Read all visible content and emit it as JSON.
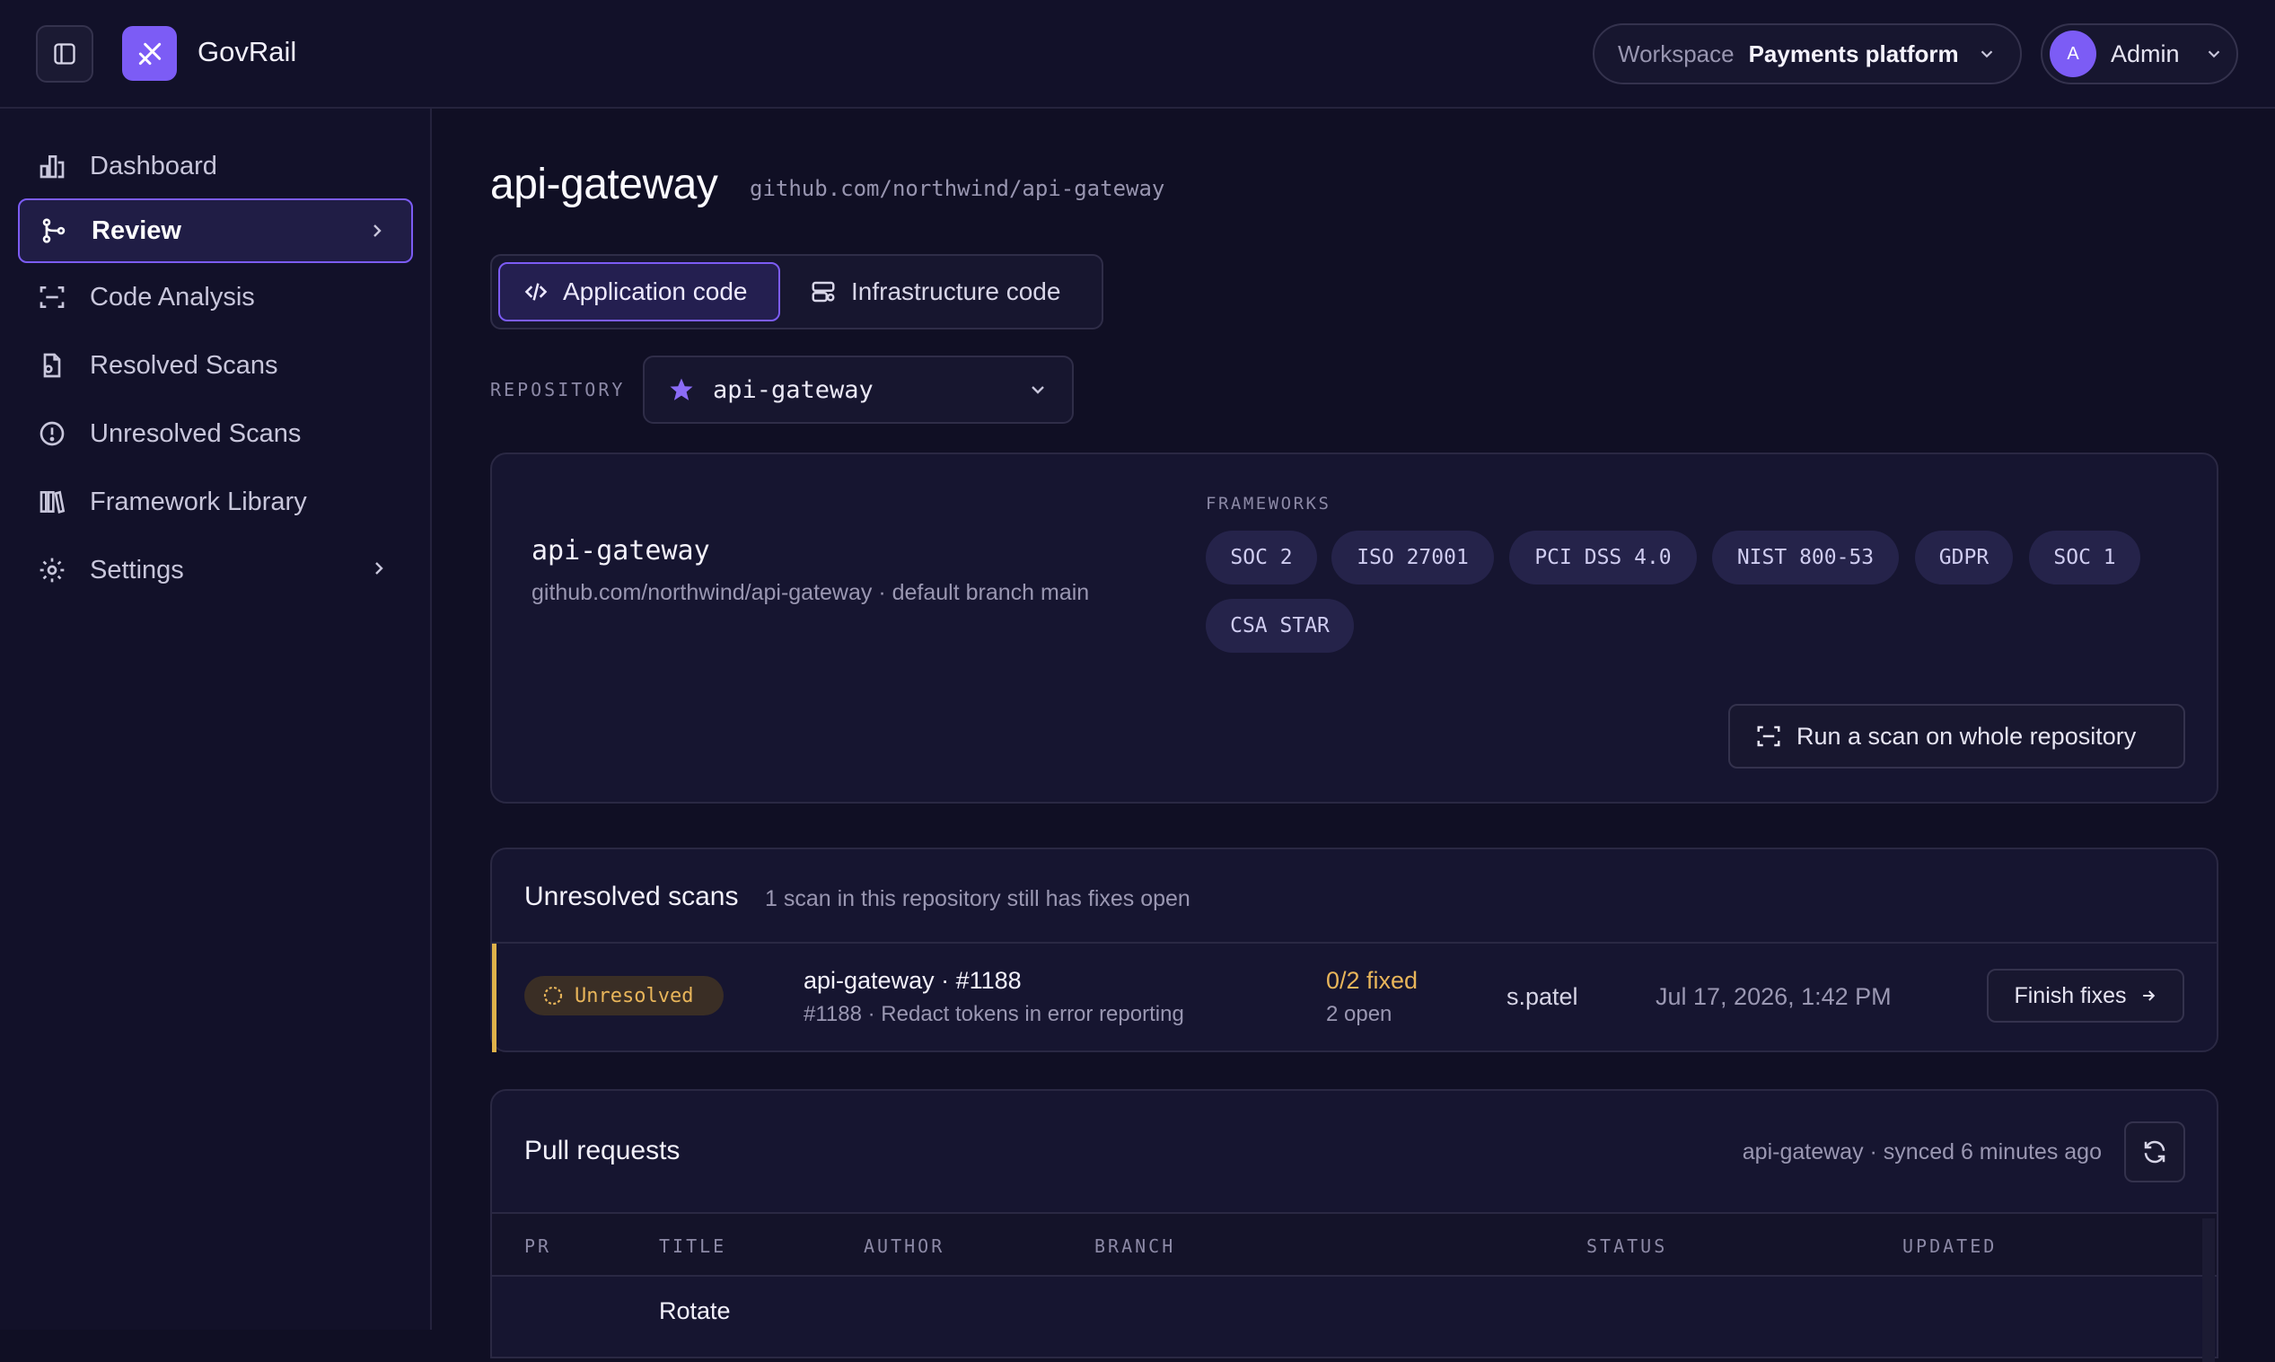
{
  "app": {
    "brand": "GovRail"
  },
  "header": {
    "workspace_label": "Workspace",
    "workspace_value": "Payments platform",
    "user_initial": "A",
    "user_name": "Admin"
  },
  "sidebar": {
    "items": [
      {
        "label": "Dashboard",
        "icon": "bar-chart-icon"
      },
      {
        "label": "Review",
        "icon": "git-branch-icon"
      },
      {
        "label": "Code Analysis",
        "icon": "scan-icon"
      },
      {
        "label": "Resolved Scans",
        "icon": "file-check-icon"
      },
      {
        "label": "Unresolved Scans",
        "icon": "alert-circle-icon"
      },
      {
        "label": "Framework Library",
        "icon": "library-icon"
      },
      {
        "label": "Settings",
        "icon": "gear-icon"
      }
    ]
  },
  "page": {
    "title": "api-gateway",
    "url": "github.com/northwind/api-gateway"
  },
  "tabs": {
    "application": "Application code",
    "infrastructure": "Infrastructure code"
  },
  "repository": {
    "label": "REPOSITORY",
    "selected": "api-gateway"
  },
  "repo_card": {
    "name": "api-gateway",
    "meta": "github.com/northwind/api-gateway · default branch main",
    "frameworks_label": "FRAMEWORKS",
    "frameworks": [
      "SOC 2",
      "ISO 27001",
      "PCI DSS 4.0",
      "NIST 800-53",
      "GDPR",
      "SOC 1",
      "CSA STAR"
    ],
    "scan_button": "Run a scan on whole repository"
  },
  "unresolved": {
    "title": "Unresolved scans",
    "subtitle": "1 scan in this repository still has fixes open",
    "row": {
      "status": "Unresolved",
      "title": "api-gateway · #1188",
      "subtitle": "#1188 · Redact tokens in error reporting",
      "fixed": "0/2 fixed",
      "open": "2 open",
      "owner": "s.patel",
      "timestamp": "Jul 17, 2026, 1:42 PM",
      "action": "Finish fixes"
    }
  },
  "pull_requests": {
    "title": "Pull requests",
    "sync": "api-gateway · synced 6 minutes ago",
    "columns": [
      "PR",
      "TITLE",
      "AUTHOR",
      "BRANCH",
      "STATUS",
      "UPDATED"
    ],
    "rows": [
      {
        "title": "Rotate"
      }
    ]
  },
  "colors": {
    "accent": "#7c5cf5",
    "background": "#100f24",
    "warning": "#e8b55a"
  }
}
